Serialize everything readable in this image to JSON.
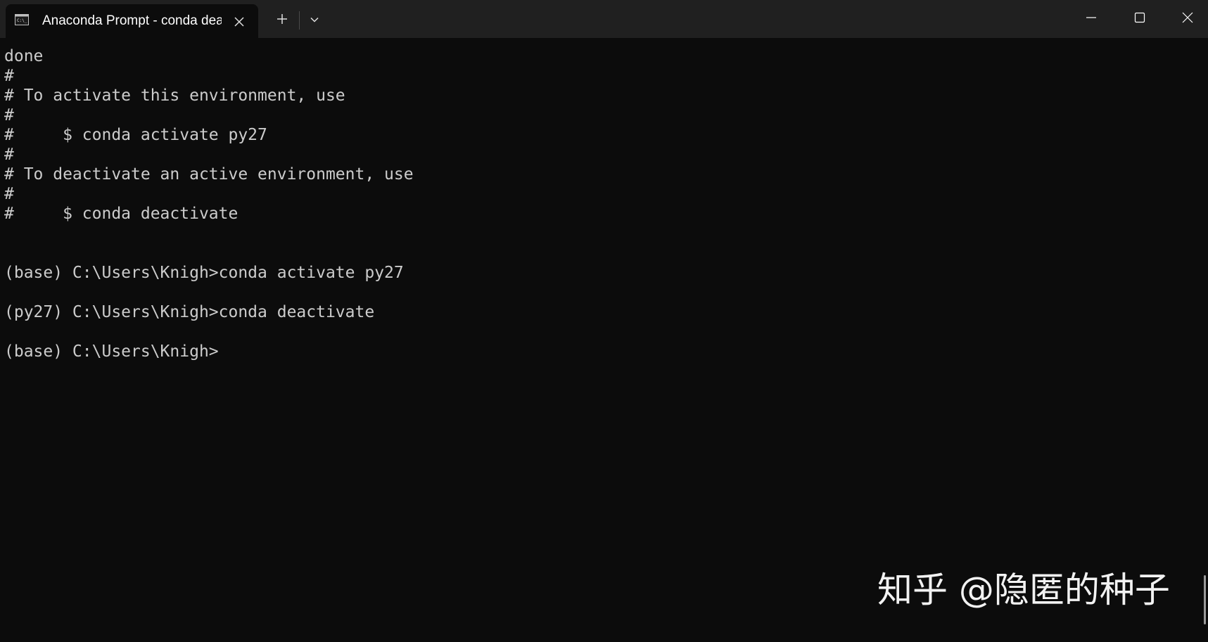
{
  "tab": {
    "title": "Anaconda Prompt - conda  deactivate",
    "icon": "terminal-icon"
  },
  "titlebar": {
    "new_tab_icon": "plus-icon",
    "dropdown_icon": "chevron-down-icon",
    "minimize_icon": "minimize-icon",
    "maximize_icon": "maximize-icon",
    "close_icon": "close-icon"
  },
  "terminal": {
    "lines": [
      "done",
      "#",
      "# To activate this environment, use",
      "#",
      "#     $ conda activate py27",
      "#",
      "# To deactivate an active environment, use",
      "#",
      "#     $ conda deactivate",
      "",
      "",
      "(base) C:\\Users\\Knigh>conda activate py27",
      "",
      "(py27) C:\\Users\\Knigh>conda deactivate",
      "",
      "(base) C:\\Users\\Knigh>"
    ]
  },
  "watermark": {
    "text": "知乎 @隐匿的种子"
  },
  "colors": {
    "background": "#0c0c0c",
    "titlebar": "#202020",
    "text": "#cccccc"
  }
}
